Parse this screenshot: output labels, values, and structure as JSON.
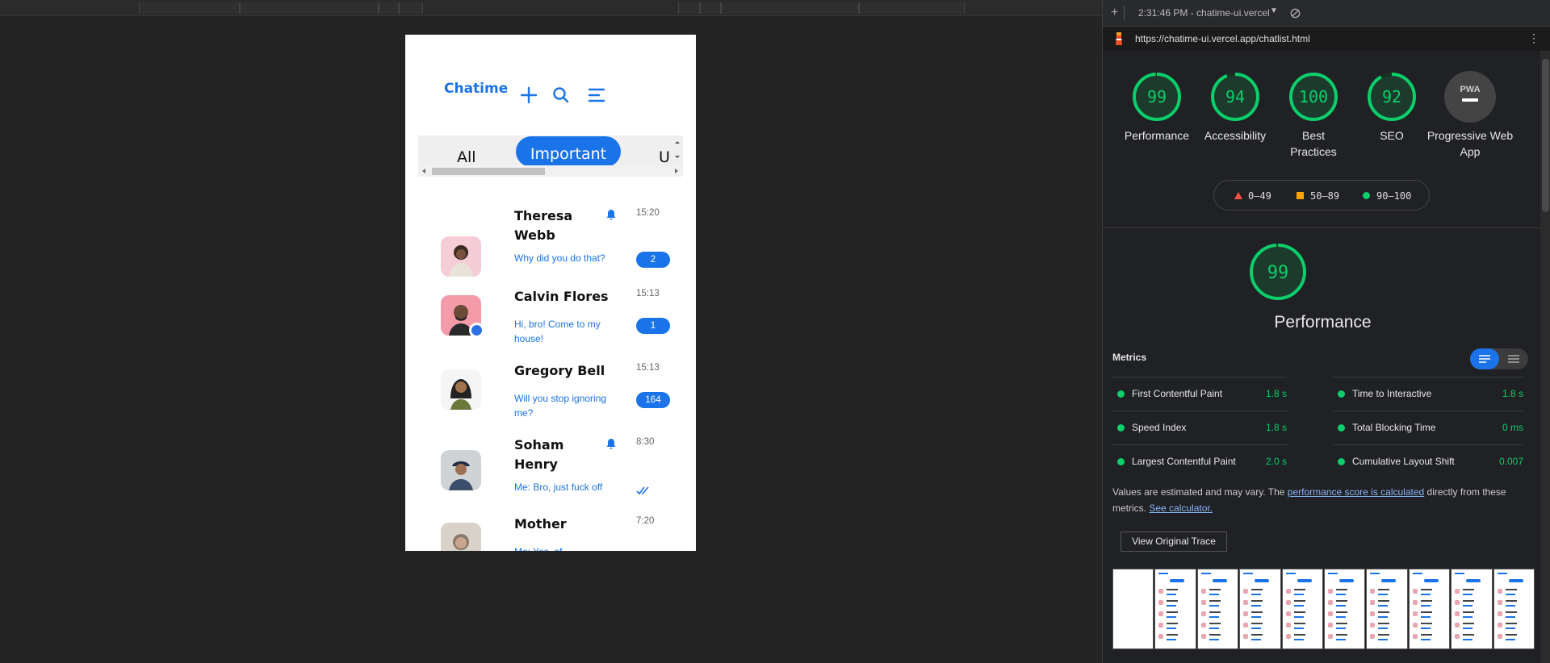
{
  "phone": {
    "brand": "Chatime",
    "tabs": [
      "All",
      "Important",
      "U"
    ],
    "chats": [
      {
        "name": "Theresa Webb",
        "message": "Why did you do that?",
        "time": "15:20",
        "badge": "2",
        "muted": true,
        "online": false,
        "avatar_color": "#f6cdd6"
      },
      {
        "name": "Calvin Flores",
        "message": "Hi, bro! Come to my house!",
        "time": "15:13",
        "badge": "1",
        "muted": false,
        "online": true,
        "avatar_color": "#f49aa8"
      },
      {
        "name": "Gregory Bell",
        "message": "Will you stop ignoring me?",
        "time": "15:13",
        "badge": "164",
        "muted": false,
        "online": false,
        "avatar_color": "#f5f5f5"
      },
      {
        "name": "Soham Henry",
        "message": "Me: Bro, just fuck off",
        "time": "8:30",
        "badge": "",
        "muted": true,
        "online": false,
        "avatar_color": "#cfd3d6"
      },
      {
        "name": "Mother",
        "message": "Me: Yes, of...",
        "time": "7:20",
        "badge": "",
        "muted": false,
        "online": false,
        "avatar_color": "#d9d2c9"
      }
    ]
  },
  "devtools": {
    "timestamp": "2:31:46 PM - chatime-ui.vercel",
    "url": "https://chatime-ui.vercel.app/chatlist.html",
    "categories": [
      {
        "label": "Performance",
        "score": "99",
        "value": 99
      },
      {
        "label": "Accessibility",
        "score": "94",
        "value": 94
      },
      {
        "label": "Best Practices",
        "score": "100",
        "value": 100
      },
      {
        "label": "SEO",
        "score": "92",
        "value": 92
      },
      {
        "label": "Progressive Web App",
        "score": "PWA",
        "value": null
      }
    ],
    "legend": {
      "low": "0–49",
      "mid": "50–89",
      "high": "90–100"
    },
    "main_score": "99",
    "main_label": "Performance",
    "metrics_title": "Metrics",
    "metrics": [
      {
        "label": "First Contentful Paint",
        "value": "1.8 s"
      },
      {
        "label": "Time to Interactive",
        "value": "1.8 s"
      },
      {
        "label": "Speed Index",
        "value": "1.8 s"
      },
      {
        "label": "Total Blocking Time",
        "value": "0 ms"
      },
      {
        "label": "Largest Contentful Paint",
        "value": "2.0 s"
      },
      {
        "label": "Cumulative Layout Shift",
        "value": "0.007"
      }
    ],
    "note_prefix": "Values are estimated and may vary. The ",
    "note_link1": "performance score is calculated",
    "note_mid": " directly from these metrics. ",
    "note_link2": "See calculator.",
    "trace_button": "View Original Trace",
    "colors": {
      "pass": "#0cce6b",
      "average": "#ffa400",
      "fail": "#ff4e42",
      "accent": "#1a73e8"
    }
  }
}
